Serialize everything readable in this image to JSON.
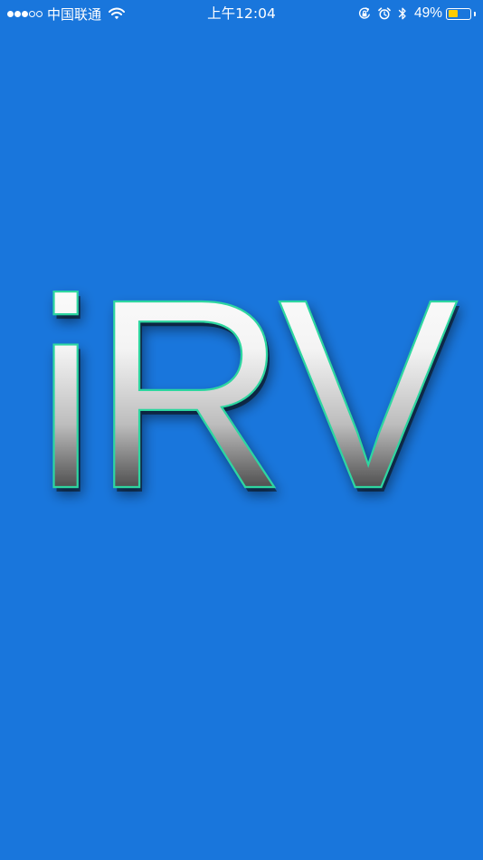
{
  "status_bar": {
    "signal_strength": 3,
    "signal_max": 5,
    "carrier": "中国联通",
    "time": "上午12:04",
    "battery_percent": "49%",
    "battery_level": 0.49,
    "icons": [
      "wifi-icon",
      "rotation-lock-icon",
      "alarm-icon",
      "bluetooth-icon",
      "battery-icon"
    ]
  },
  "splash": {
    "logo_text": "iRV"
  },
  "colors": {
    "background": "#1976DC",
    "battery_fill": "#FFCC00",
    "logo_outline": "#2FD6A0",
    "status_text": "#FFFFFF"
  }
}
